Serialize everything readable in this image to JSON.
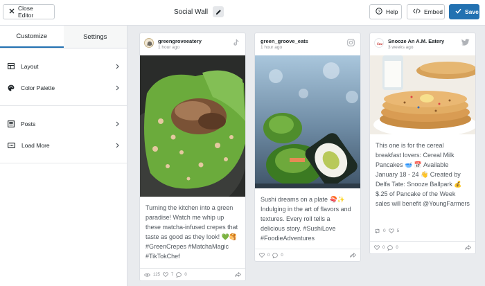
{
  "topbar": {
    "close_label": "Close Editor",
    "title": "Social Wall",
    "help_label": "Help",
    "embed_label": "Embed",
    "save_label": "Save"
  },
  "sidebar": {
    "tabs": [
      "Customize",
      "Settings"
    ],
    "items": [
      {
        "label": "Layout",
        "icon": "layout-icon"
      },
      {
        "label": "Color Palette",
        "icon": "palette-icon"
      },
      {
        "label": "Posts",
        "icon": "posts-icon"
      },
      {
        "label": "Load More",
        "icon": "load-more-icon"
      }
    ]
  },
  "posts": [
    {
      "username": "greengroveeatery",
      "time": "1 hour ago",
      "network": "tiktok-icon",
      "text": "Turning the kitchen into a green paradise! Watch me whip up these matcha-infused crepes that taste as good as they look! 💚🥞 #GreenCrepes #MatchaMagic #TikTokChef",
      "views": "125",
      "likes": "7",
      "comments": "0"
    },
    {
      "username": "green_groove_eats",
      "time": "1 hour ago",
      "network": "instagram-icon",
      "text": "Sushi dreams on a plate 🍣✨ Indulging in the art of flavors and textures. Every roll tells a delicious story. #SushiLove #FoodieAdventures",
      "likes": "0",
      "comments": "0"
    },
    {
      "username": "Snooze An A.M. Eatery",
      "time": "3 weeks ago",
      "network": "twitter-icon",
      "text": "This one is for the cereal breakfast lovers: Cereal Milk Pancakes 🥣 📅 Available January 18 - 24 👋 Created by Delfa Tate: Snooze Ballpark 💰 $.25 of Pancake of the Week sales will benefit @YoungFarmers",
      "retweets": "0",
      "likes": "5",
      "footer_likes": "0",
      "footer_comments": "0"
    }
  ],
  "colors": {
    "accent": "#2271b1",
    "background": "#e9ebee"
  }
}
